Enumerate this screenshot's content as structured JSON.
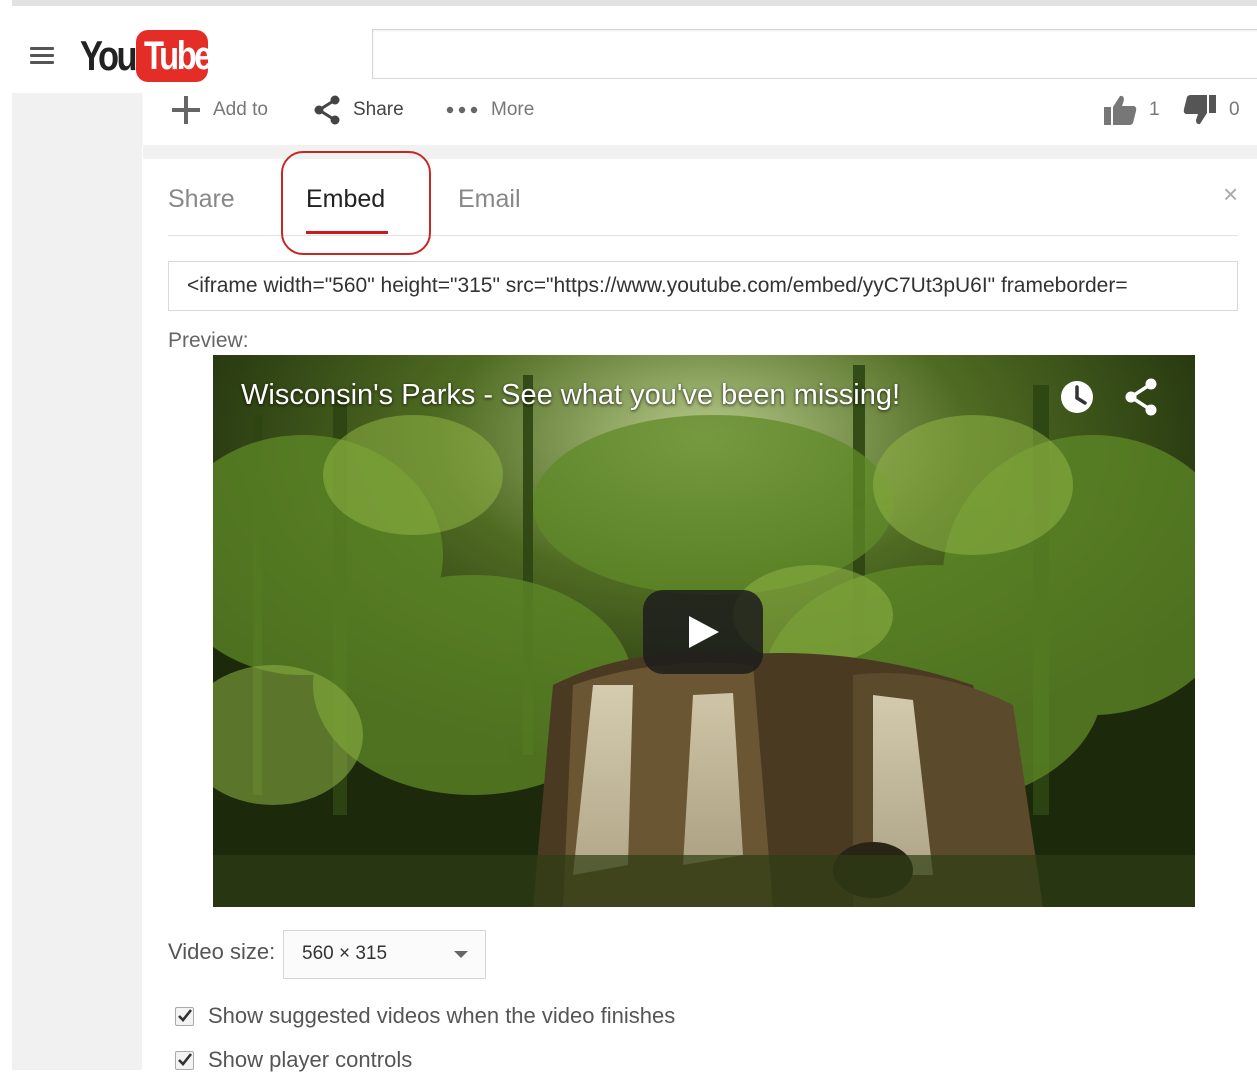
{
  "header": {
    "logo_you": "You",
    "logo_tube": "Tube",
    "search_value": ""
  },
  "actions": {
    "add_to": "Add to",
    "share": "Share",
    "more": "More",
    "likes": "1",
    "dislikes": "0"
  },
  "share_panel": {
    "tabs": [
      {
        "label": "Share",
        "active": false
      },
      {
        "label": "Embed",
        "active": true
      },
      {
        "label": "Email",
        "active": false
      }
    ],
    "close_glyph": "×",
    "embed_code": "<iframe width=\"560\" height=\"315\" src=\"https://www.youtube.com/embed/yyC7Ut3pU6I\" frameborder=",
    "preview_label": "Preview:",
    "video_title": "Wisconsin's Parks - See what you've been missing!",
    "video_size_label": "Video size:",
    "video_size_value": "560 × 315",
    "options": [
      {
        "label": "Show suggested videos when the video finishes",
        "checked": true
      },
      {
        "label": "Show player controls",
        "checked": true
      }
    ]
  },
  "colors": {
    "brand_red": "#e52d27",
    "active_tab_underline": "#cc181e",
    "callout_border": "#c62828"
  }
}
